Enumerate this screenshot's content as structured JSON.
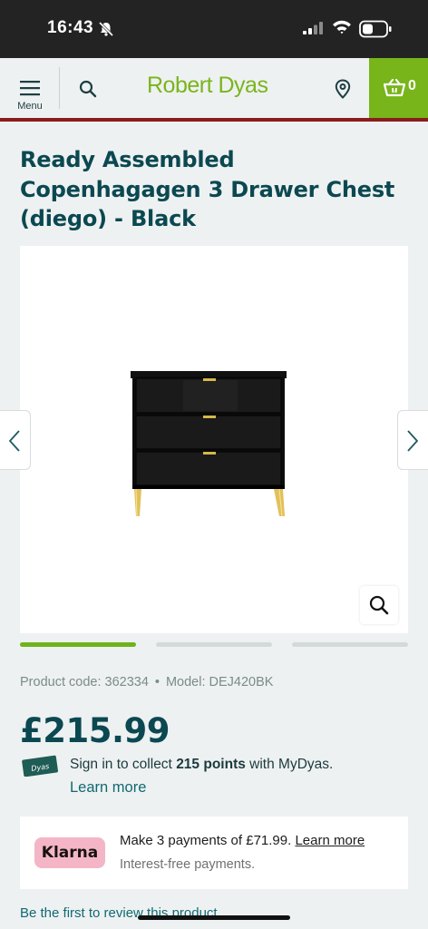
{
  "status_bar": {
    "time": "16:43",
    "icons": [
      "bell-slash-icon",
      "signal-icon",
      "wifi-icon",
      "battery-icon"
    ]
  },
  "header": {
    "menu_label": "Menu",
    "brand": "Robert Dyas",
    "basket_count": "0",
    "icons": [
      "hamburger-icon",
      "search-icon",
      "location-pin-icon",
      "basket-icon"
    ],
    "colors": {
      "brand_green": "#77b51b",
      "accent_rule": "#8b1c1c",
      "title_teal": "#0b4851"
    }
  },
  "product": {
    "title": "Ready Assembled Copenhagagen 3 Drawer Chest (diego) - Black",
    "code_label": "Product code: 362334",
    "separator": "•",
    "model_label": "Model: DEJ420BK",
    "price": "£215.99",
    "gallery": {
      "image_count": 3,
      "active_index": 1,
      "image_alt": "Black 3 drawer chest with gold legs"
    }
  },
  "loyalty": {
    "card_label": "Dyas",
    "text_before": "Sign in to collect ",
    "points": "215 points",
    "text_after": " with MyDyas.",
    "learn_more": "Learn more"
  },
  "klarna": {
    "badge": "Klarna",
    "line1": "Make 3 payments of £71.99.",
    "line1_link": "Learn more",
    "line2": "Interest-free payments."
  },
  "reviews": {
    "link": "Be the first to review this product"
  }
}
